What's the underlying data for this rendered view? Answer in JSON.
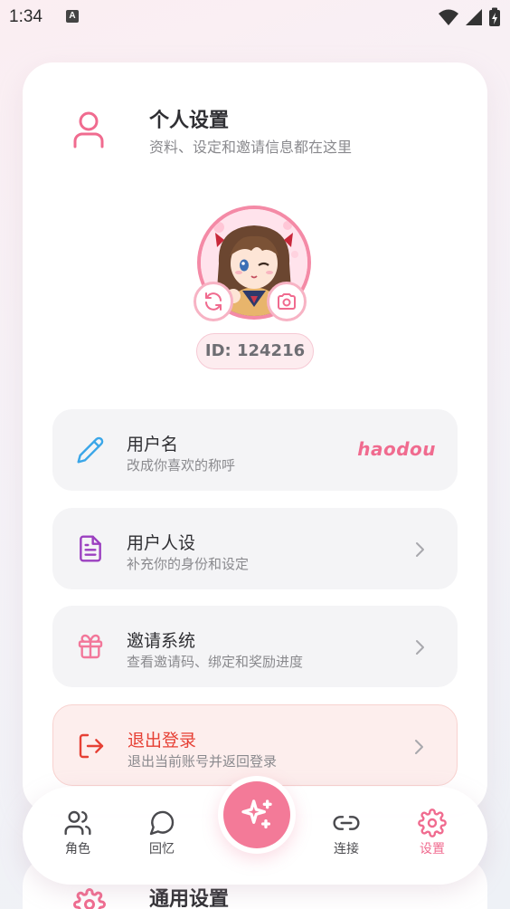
{
  "status_bar": {
    "time": "1:34",
    "notification_badge": "A"
  },
  "header": {
    "title": "个人设置",
    "subtitle": "资料、设定和邀请信息都在这里",
    "icon": "user-icon"
  },
  "profile": {
    "id_text": "ID: 124216",
    "avatar_alt": "anime girl avatar"
  },
  "settings": [
    {
      "title": "用户名",
      "subtitle": "改成你喜欢的称呼",
      "value": "haodou",
      "icon": "pencil-icon"
    },
    {
      "title": "用户人设",
      "subtitle": "补充你的身份和设定",
      "icon": "document-icon"
    },
    {
      "title": "邀请系统",
      "subtitle": "查看邀请码、绑定和奖励进度",
      "icon": "gift-icon"
    },
    {
      "title": "退出登录",
      "subtitle": "退出当前账号并返回登录",
      "icon": "logout-icon"
    }
  ],
  "next_section": {
    "title": "通用设置",
    "icon": "gear-icon"
  },
  "bottom_nav": {
    "items": [
      {
        "label": "角色",
        "icon": "users-icon",
        "active": false
      },
      {
        "label": "回忆",
        "icon": "chat-bubble-icon",
        "active": false
      },
      {
        "label": "连接",
        "icon": "link-icon",
        "active": false
      },
      {
        "label": "设置",
        "icon": "gear-icon",
        "active": true
      }
    ],
    "center_icon": "sparkle-icon"
  },
  "colors": {
    "accent": "#f06b8f",
    "accent_soft": "#fdecef",
    "danger": "#e64035",
    "pencil": "#3aa6e8",
    "document": "#9b3fc0",
    "gift": "#f2779a"
  }
}
